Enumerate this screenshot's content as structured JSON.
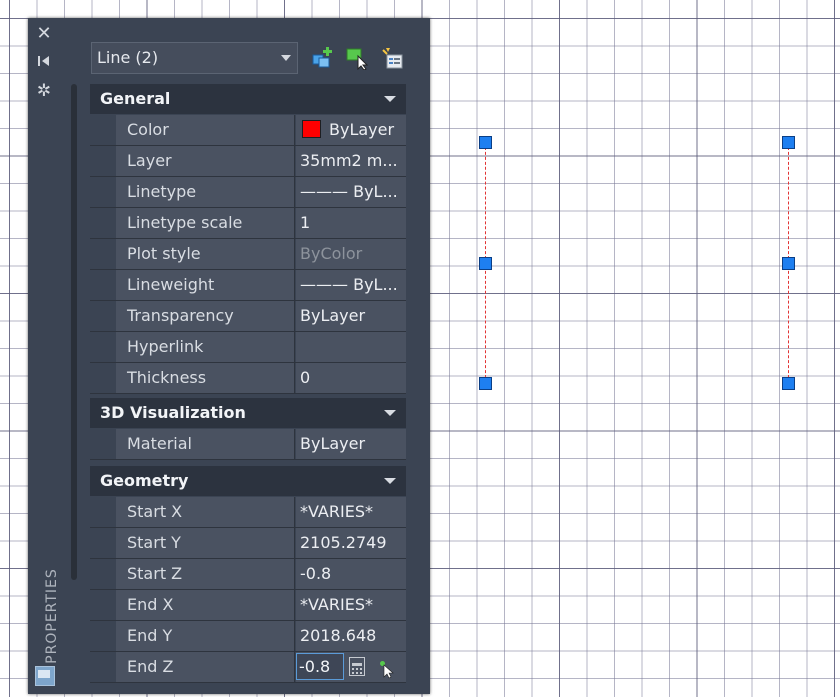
{
  "palette": {
    "vertical_title": "PROPERTIES",
    "selector": {
      "value": "Line (2)"
    },
    "side_icons": [
      "close-icon",
      "auto-hide-icon",
      "properties-settings-icon"
    ],
    "toolbar_icons": [
      "toggle-pickadd-icon",
      "select-objects-icon",
      "quick-select-icon"
    ],
    "general": {
      "title": "General",
      "rows": [
        {
          "label": "Color",
          "value": "ByLayer",
          "swatch": "#ff0000"
        },
        {
          "label": "Layer",
          "value": "35mm2 m..."
        },
        {
          "label": "Linetype",
          "value": "——— ByL..."
        },
        {
          "label": "Linetype scale",
          "value": "1"
        },
        {
          "label": "Plot style",
          "value": "ByColor"
        },
        {
          "label": "Lineweight",
          "value": "——— ByL..."
        },
        {
          "label": "Transparency",
          "value": "ByLayer"
        },
        {
          "label": "Hyperlink",
          "value": ""
        },
        {
          "label": "Thickness",
          "value": "0"
        }
      ]
    },
    "viz": {
      "title": "3D Visualization",
      "rows": [
        {
          "label": "Material",
          "value": "ByLayer"
        }
      ]
    },
    "geometry": {
      "title": "Geometry",
      "rows": [
        {
          "label": "Start X",
          "value": "*VARIES*"
        },
        {
          "label": "Start Y",
          "value": "2105.2749"
        },
        {
          "label": "Start Z",
          "value": "-0.8"
        },
        {
          "label": "End X",
          "value": "*VARIES*"
        },
        {
          "label": "End Y",
          "value": "2018.648"
        },
        {
          "label": "End Z",
          "value": "-0.8"
        }
      ]
    }
  },
  "canvas": {
    "line_color": "#e23434",
    "grip_color": "#1e7ff0"
  }
}
